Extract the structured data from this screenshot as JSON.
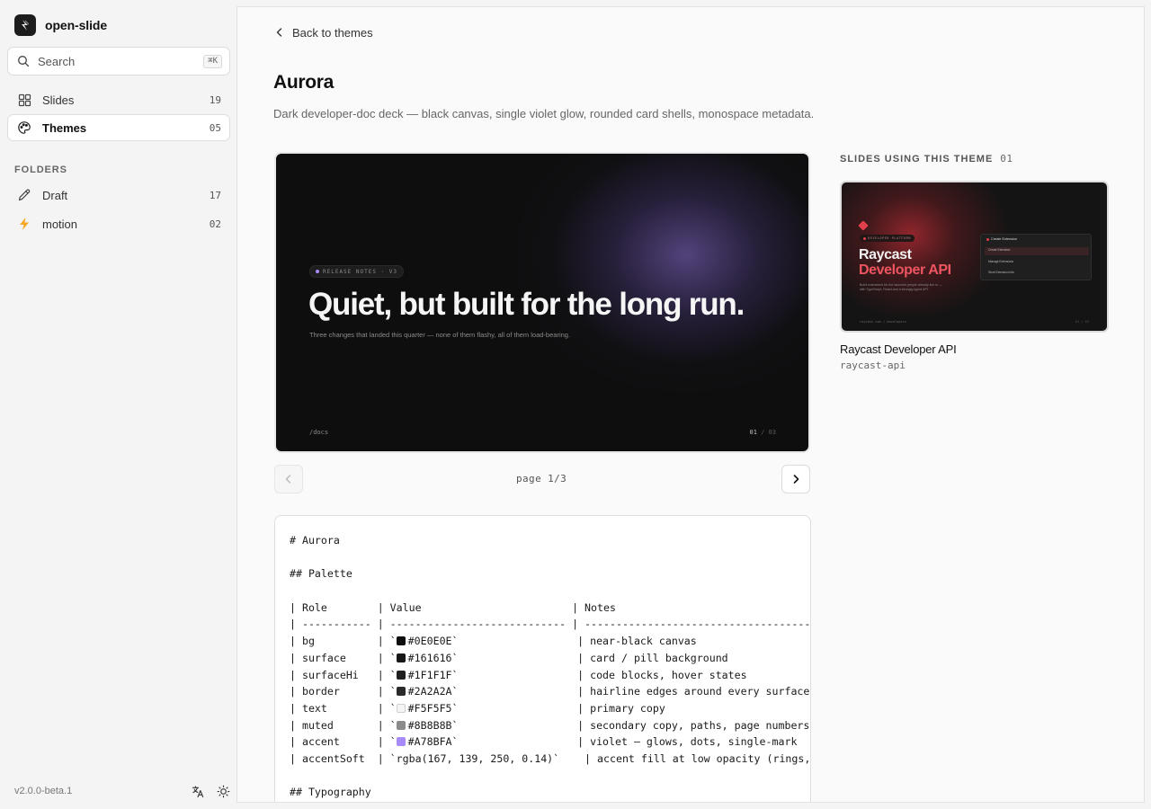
{
  "sidebar": {
    "brand": "open-slide",
    "search": {
      "placeholder": "Search",
      "shortcut": "⌘K"
    },
    "nav": [
      {
        "label": "Slides",
        "count": "19",
        "icon": "grid-icon",
        "active": false
      },
      {
        "label": "Themes",
        "count": "05",
        "icon": "palette-icon",
        "active": true
      }
    ],
    "folders_title": "FOLDERS",
    "folders": [
      {
        "label": "Draft",
        "count": "17",
        "icon": "pencil-icon"
      },
      {
        "label": "motion",
        "count": "02",
        "icon": "lightning-icon"
      }
    ],
    "version": "v2.0.0-beta.1"
  },
  "main": {
    "back_label": "Back to themes",
    "title": "Aurora",
    "description": "Dark developer-doc deck — black canvas, single violet glow, rounded card shells, monospace metadata.",
    "preview": {
      "pill": "RELEASE NOTES · V3",
      "headline": "Quiet, but built for the long run.",
      "subtitle": "Three changes that landed this quarter — none of them flashy, all of them load-bearing.",
      "path": "/docs",
      "page_current": "01",
      "page_rest": " / 03"
    },
    "pager_label": "page 1/3",
    "markdown": {
      "h1": "# Aurora",
      "h2_palette": "## Palette",
      "header_row": "| Role        | Value                        | Notes",
      "divider_row": "| ----------- | ---------------------------- | --------------------------------------------",
      "rows": [
        {
          "role": "| bg          | `",
          "value": "#0E0E0E`",
          "notes": "                   | near-black canvas",
          "color": "#0E0E0E"
        },
        {
          "role": "| surface     | `",
          "value": "#161616`",
          "notes": "                   | card / pill background",
          "color": "#161616"
        },
        {
          "role": "| surfaceHi   | `",
          "value": "#1F1F1F`",
          "notes": "                   | code blocks, hover states",
          "color": "#1F1F1F"
        },
        {
          "role": "| border      | `",
          "value": "#2A2A2A`",
          "notes": "                   | hairline edges around every surface",
          "color": "#2A2A2A"
        },
        {
          "role": "| text        | `",
          "value": "#F5F5F5`",
          "notes": "                   | primary copy",
          "color": "#F5F5F5"
        },
        {
          "role": "| muted       | `",
          "value": "#8B8B8B`",
          "notes": "                   | secondary copy, paths, page numbers",
          "color": "#8B8B8B"
        },
        {
          "role": "| accent      | `",
          "value": "#A78BFA`",
          "notes": "                   | violet — glows, dots, single-mark",
          "color": "#A78BFA"
        }
      ],
      "accent_soft_row": "| accentSoft  | `rgba(167, 139, 250, 0.14)`    | accent fill at low opacity (rings, t",
      "h2_typography": "## Typography"
    }
  },
  "using": {
    "title": "SLIDES USING THIS THEME",
    "count": "01",
    "slide": {
      "name": "Raycast Developer API",
      "slug": "raycast-api",
      "thumb_pill": "DEVELOPER PLATFORM",
      "thumb_h1": "Raycast",
      "thumb_h2": "Developer API",
      "thumb_desc": "Build extensions for the launcher people already live in — with TypeScript, React and a strongly-typed API.",
      "thumb_panel_title": "Create Extension",
      "thumb_rows": [
        "Create Extension",
        "Manage Extensions",
        "Store Extension Info"
      ],
      "thumb_footer": "raycast.com / developers",
      "thumb_footer_r": "01 / 03"
    }
  },
  "colors": {
    "accent": "#A78BFA",
    "canvas": "#0E0E0E",
    "raycast_red": "#EF5560"
  }
}
